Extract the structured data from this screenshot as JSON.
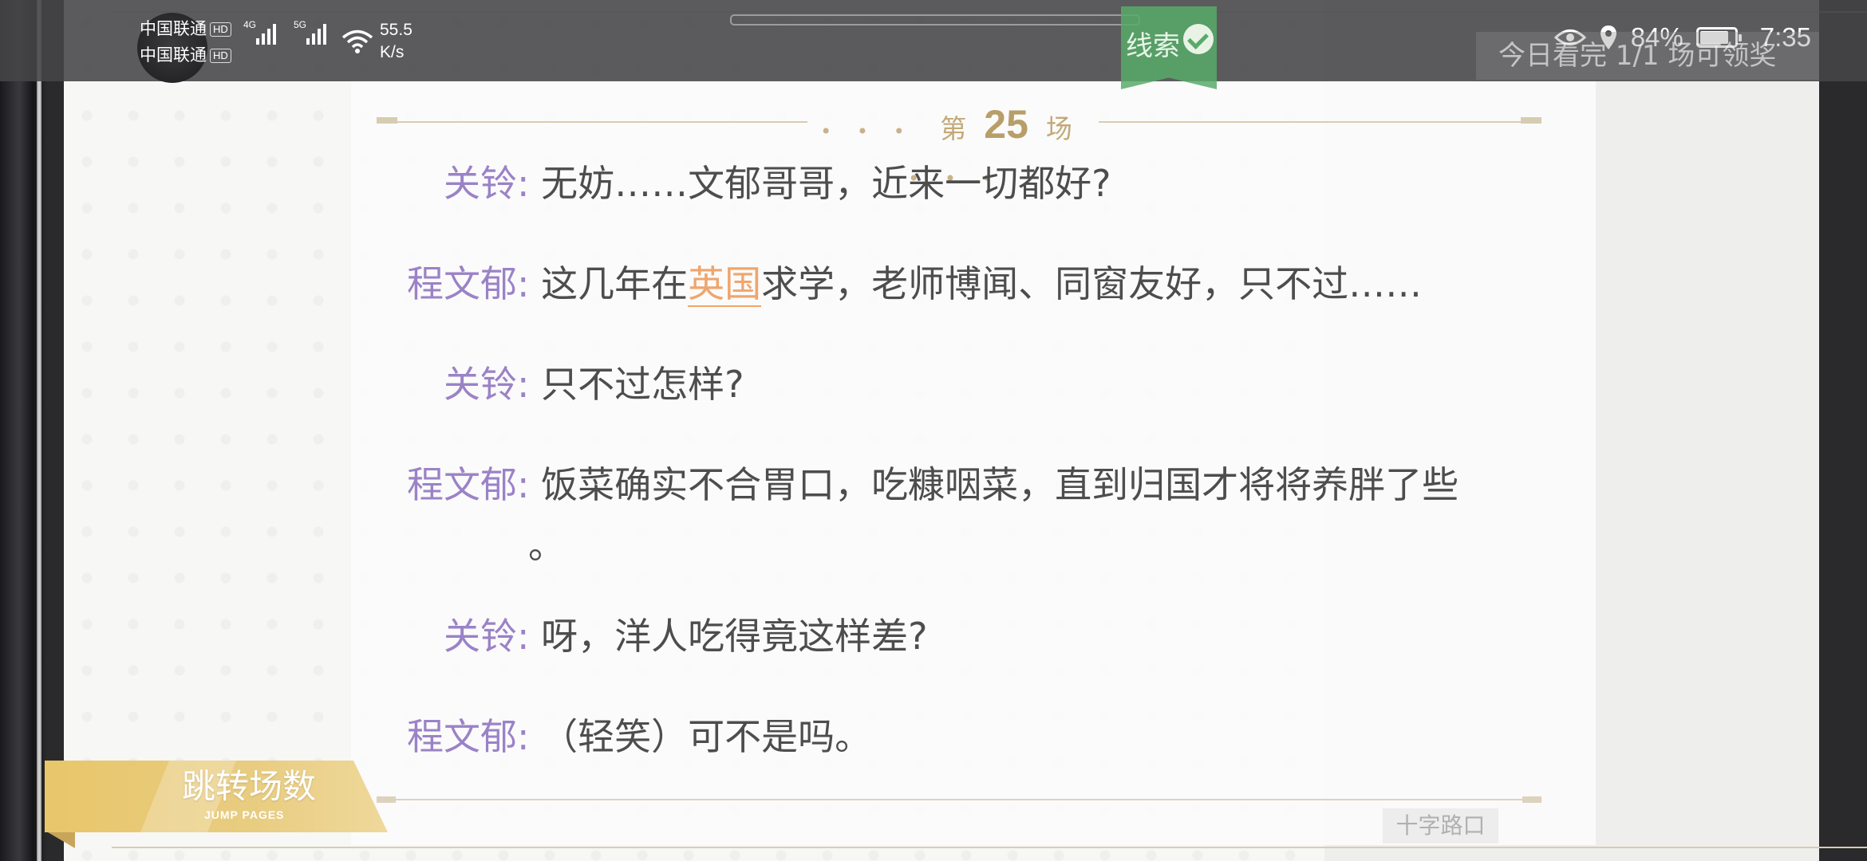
{
  "status_bar": {
    "carrier1": "中国联通",
    "carrier2": "中国联通",
    "hd_label": "HD",
    "sig1_label": "4G",
    "sig2_label": "5G",
    "net_speed_value": "55.5",
    "net_speed_unit": "K/s",
    "battery_percent": "84%",
    "battery_level": 0.84,
    "time": "7:35"
  },
  "clue": {
    "label": "线索"
  },
  "daily": {
    "text": "今日看完 1/1 场可领奖"
  },
  "scene": {
    "prefix": "第",
    "number": "25",
    "suffix": "场",
    "dots_left": "• • •",
    "dots_right": "• • •"
  },
  "dialogue": [
    {
      "speaker": "关铃",
      "text": "无妨……文郁哥哥，近来一切都好?"
    },
    {
      "speaker": "程文郁",
      "text_before": "这几年在",
      "highlight": "英国",
      "text_after": "求学，老师博闻、同窗友好，只不过……"
    },
    {
      "speaker": "关铃",
      "text": "只不过怎样?"
    },
    {
      "speaker": "程文郁",
      "text": "饭菜确实不合胃口，吃糠咽菜，直到归国才将将养胖了些",
      "continuation": "。"
    },
    {
      "speaker": "关铃",
      "text": "呀，洋人吃得竟这样差?"
    },
    {
      "speaker": "程文郁",
      "text": "（轻笑）可不是吗。"
    }
  ],
  "colon": ":",
  "location": {
    "label": "十字路口"
  },
  "jump": {
    "label": "跳转场数",
    "sub": "JUMP PAGES"
  },
  "colors": {
    "speaker": "#9b82c7",
    "highlight": "#f0a56c",
    "accent_gold": "#c2a978",
    "clue_green": "#58aa68"
  }
}
